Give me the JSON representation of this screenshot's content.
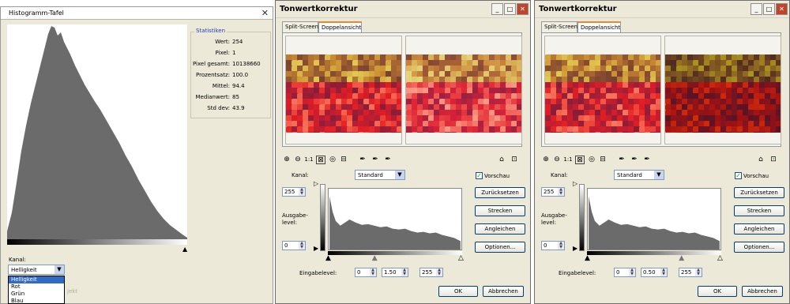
{
  "histogram_panel": {
    "title": "Histogramm-Tafel",
    "close": "✕",
    "stats_title": "Statistiken",
    "stats": [
      {
        "label": "Wert:",
        "value": "254"
      },
      {
        "label": "Pixel:",
        "value": "1"
      },
      {
        "label": "Pixel gesamt:",
        "value": "10138660"
      },
      {
        "label": "Prozentsatz:",
        "value": "100.0"
      },
      {
        "label": "Mittel:",
        "value": "94.4"
      },
      {
        "label": "Medianwert:",
        "value": "85"
      },
      {
        "label": "Std dev:",
        "value": "43.9"
      }
    ],
    "channel_label": "Kanal:",
    "channel_value": "Helligkeit",
    "channel_options": [
      "Helligkeit",
      "Rot",
      "Grün",
      "Blau"
    ],
    "ghost_text": "jekt",
    "marker": "▲"
  },
  "dialogs": [
    {
      "title": "Tonwertkorrektur",
      "tabs": [
        "Split-Screen",
        "Doppelansicht"
      ],
      "active_tab": "Doppelansicht",
      "channel_label": "Kanal:",
      "channel_value": "Standard",
      "preview_label": "Vorschau",
      "preview_checked": true,
      "output_label": "Ausgabe-\nlevel:",
      "output_top": "255",
      "output_bottom": "0",
      "input_label": "Eingabelevel:",
      "input_black": "0",
      "input_gamma": "1.50",
      "input_white": "255",
      "gamma_position": 0.35,
      "buttons": [
        "Zurücksetzen",
        "Strecken",
        "Angleichen",
        "Optionen..."
      ],
      "ok": "OK",
      "cancel": "Abbrechen"
    },
    {
      "title": "Tonwertkorrektur",
      "tabs": [
        "Split-Screen",
        "Doppelansicht"
      ],
      "active_tab": "Doppelansicht",
      "channel_label": "Kanal:",
      "channel_value": "Standard",
      "preview_label": "Vorschau",
      "preview_checked": true,
      "output_label": "Ausgabe-\nlevel:",
      "output_top": "255",
      "output_bottom": "0",
      "input_label": "Eingabelevel:",
      "input_black": "0",
      "input_gamma": "0.50",
      "input_white": "255",
      "gamma_position": 0.71,
      "buttons": [
        "Zurücksetzen",
        "Strecken",
        "Angleichen",
        "Optionen..."
      ],
      "ok": "OK",
      "cancel": "Abbrechen"
    }
  ],
  "window_buttons": [
    "_",
    "□",
    "✕"
  ],
  "toolbar_icons": [
    "zoom-in-icon",
    "zoom-out-icon",
    "actual-size-icon",
    "fit-window-icon",
    "navigator-icon",
    "pan-icon",
    "black-eyedropper-icon",
    "gray-eyedropper-icon",
    "white-eyedropper-icon",
    "save-settings-icon",
    "load-settings-icon"
  ],
  "colors": {
    "titlebar_close": "#c0442b",
    "accent_tab": "#e68b2c",
    "histogram_fill": "#6b6b6b"
  }
}
